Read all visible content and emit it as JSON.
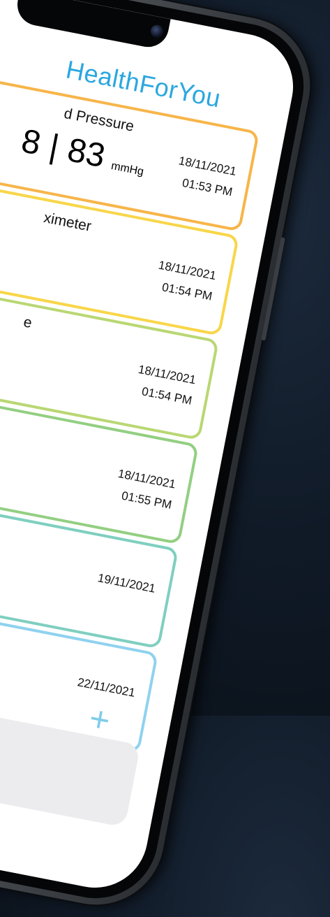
{
  "app": {
    "title": "HealthForYou"
  },
  "cards": [
    {
      "title": "d Pressure",
      "value_systolic": "8",
      "value_diastolic": "83",
      "unit": "mmHg",
      "date": "18/11/2021",
      "time": "01:53 PM",
      "color": "#f7b54a"
    },
    {
      "title": "ximeter",
      "date": "18/11/2021",
      "time": "01:54 PM",
      "color": "#f8d64a"
    },
    {
      "title": "e",
      "date": "18/11/2021",
      "time": "01:54 PM",
      "color": "#b9d773"
    },
    {
      "date": "18/11/2021",
      "time": "01:55 PM",
      "color": "#93cf82"
    },
    {
      "date": "19/11/2021",
      "color": "#7fcfc0"
    },
    {
      "date": "22/11/2021",
      "add_label": "+",
      "color": "#8fd2ef"
    }
  ],
  "colors": {
    "accent": "#2aa7e0"
  }
}
